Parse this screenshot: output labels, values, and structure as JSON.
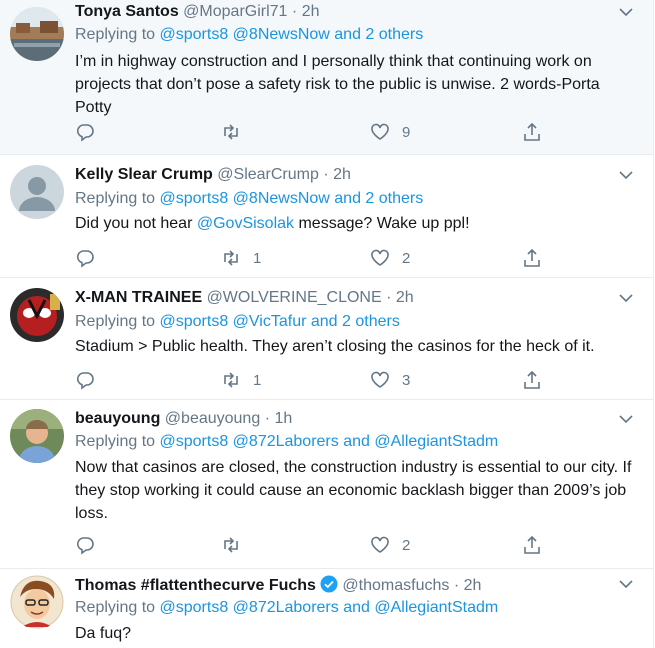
{
  "tweets": [
    {
      "name": "Tonya Santos",
      "handle": "@MoparGirl71",
      "dot": "·",
      "time": "2h",
      "replying_prefix": "Replying to ",
      "mention1": "@sports8",
      "mention2": "@8NewsNow",
      "others": "and 2 others",
      "text": "I’m in highway construction and I personally think that continuing work on projects that don’t pose a safety risk to the public is unwise. 2 words-Porta Potty",
      "replies": "",
      "retweets": "",
      "likes": "9"
    },
    {
      "name": "Kelly Slear Crump",
      "handle": "@SlearCrump",
      "dot": "·",
      "time": "2h",
      "replying_prefix": "Replying to ",
      "mention1": "@sports8",
      "mention2": "@8NewsNow",
      "others": "and 2 others",
      "text_before": "Did you not hear ",
      "text_mention": "@GovSisolak",
      "text_after": " message? Wake up ppl!",
      "replies": "",
      "retweets": "1",
      "likes": "2"
    },
    {
      "name": "X-MAN TRAINEE",
      "handle": "@WOLVERINE_CLONE",
      "dot": "·",
      "time": "2h",
      "replying_prefix": "Replying to ",
      "mention1": "@sports8",
      "mention2": "@VicTafur",
      "others": "and 2 others",
      "text": "Stadium > Public health. They aren’t closing the casinos for the heck of it.",
      "replies": "",
      "retweets": "1",
      "likes": "3"
    },
    {
      "name": "beauyoung",
      "handle": "@beauyoung",
      "dot": "·",
      "time": "1h",
      "replying_prefix": "Replying to ",
      "mention1": "@sports8",
      "mention2": "@872Laborers",
      "and_word": "and",
      "mention3": "@AllegiantStadm",
      "text": "Now that casinos are closed, the construction industry is essential to our city. If they stop working it could cause an economic backlash bigger than 2009’s job loss.",
      "replies": "",
      "retweets": "",
      "likes": "2"
    },
    {
      "name": "Thomas #flattenthecurve Fuchs",
      "handle": "@thomasfuchs",
      "dot": "·",
      "time": "2h",
      "replying_prefix": "Replying to ",
      "mention1": "@sports8",
      "mention2": "@872Laborers",
      "and_word": "and",
      "mention3": "@AllegiantStadm",
      "text": "Da fuq?"
    }
  ],
  "colors": {
    "link": "#1b95e0",
    "muted": "#657786",
    "highlight_bg": "#f5f8fa",
    "verified": "#1da1f2"
  },
  "icons": [
    "reply-icon",
    "retweet-icon",
    "like-icon",
    "share-icon",
    "chevron-down-icon",
    "verified-icon"
  ]
}
